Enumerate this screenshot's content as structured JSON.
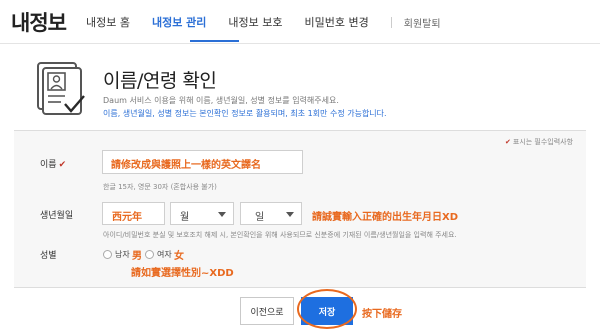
{
  "header": {
    "logo": "내정보",
    "nav": [
      "내정보 홈",
      "내정보 관리",
      "내정보 보호",
      "비밀번호 변경"
    ],
    "nav_extra": "회원탈퇴",
    "active_nav": "내정보 관리"
  },
  "intro": {
    "title": "이름/연령 확인",
    "desc1": "Daum 서비스 이용을 위해 이름, 생년월일, 성별 정보를 입력해주세요.",
    "desc2": "이름, 생년월일, 성별 정보는 본인확인 정보로 활용되며, 최초 1회만 수정 가능합니다."
  },
  "form": {
    "required_note": "표시는 필수입력사항",
    "name": {
      "label": "이름",
      "value": "請修改成與護照上一樣的英文譯名",
      "hint": "한글 15자, 영문 30자 (혼합사용 불가)"
    },
    "birth": {
      "label": "생년월일",
      "year": "西元年",
      "month": "월",
      "day": "일",
      "annotation": "請誠實輸入正確的出生年月日XD",
      "hint": "아이디/비밀번호 분실 및 보호조치 해제 시, 본인확인을 위해 사용되므로 신분증에 기재된 이름/생년월일을 입력해 주세요."
    },
    "gender": {
      "label": "성별",
      "male": "남자",
      "male_annot": "男",
      "female": "여자",
      "female_annot": "女",
      "annotation": "請如實選擇性別~XDD"
    }
  },
  "buttons": {
    "prev": "이전으로",
    "save": "저장",
    "save_annotation": "按下儲存"
  },
  "colors": {
    "accent_blue": "#1e6fe0",
    "annotation_orange": "#e8691f",
    "required_red": "#c0392b"
  }
}
